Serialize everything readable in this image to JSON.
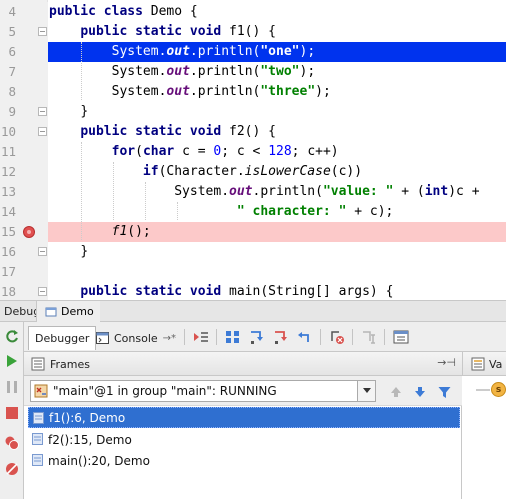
{
  "editor": {
    "lines": [
      {
        "num": "4"
      },
      {
        "num": "5"
      },
      {
        "num": "6"
      },
      {
        "num": "7"
      },
      {
        "num": "8"
      },
      {
        "num": "9"
      },
      {
        "num": "10"
      },
      {
        "num": "11"
      },
      {
        "num": "12"
      },
      {
        "num": "13"
      },
      {
        "num": "14"
      },
      {
        "num": "15"
      },
      {
        "num": "16"
      },
      {
        "num": "17"
      },
      {
        "num": "18"
      }
    ],
    "code": {
      "l4": {
        "kw": "public class",
        "rest": " Demo {"
      },
      "l5": {
        "kw": "public static void",
        "rest": " f1() {"
      },
      "l6": {
        "a": "System.",
        "fld": "out",
        "b": ".println(",
        "str": "\"one\"",
        "c": ");"
      },
      "l7": {
        "a": "System.",
        "fld": "out",
        "b": ".println(",
        "str": "\"two\"",
        "c": ");"
      },
      "l8": {
        "a": "System.",
        "fld": "out",
        "b": ".println(",
        "str": "\"three\"",
        "c": ");"
      },
      "l9": {
        "rest": "}"
      },
      "l10": {
        "kw": "public static void",
        "rest": " f2() {"
      },
      "l11": {
        "kw1": "for",
        "a": "(",
        "kw2": "char",
        "b": " c = ",
        "n1": "0",
        "c": "; c < ",
        "n2": "128",
        "d": "; c++)"
      },
      "l12": {
        "kw": "if",
        "a": "(Character.",
        "sm": "isLowerCase",
        "b": "(c))"
      },
      "l13": {
        "a": "System.",
        "fld": "out",
        "b": ".println(",
        "str": "\"value: \"",
        "c": " + (",
        "kw": "int",
        "d": ")c +"
      },
      "l14": {
        "str": "\" character: \"",
        "c": " + c);"
      },
      "l15": {
        "sm": "f1",
        "rest": "();"
      },
      "l16": {
        "rest": "}"
      },
      "l17": {
        "rest": ""
      },
      "l18": {
        "kw": "public static void",
        "rest": " main(String[] args) {"
      }
    }
  },
  "debug_bar": {
    "label": "Debug",
    "tab_label": "Demo"
  },
  "toolbar": {
    "debugger_tab": "Debugger",
    "console_tab": "Console",
    "console_suffix": "→*"
  },
  "frames_panel": {
    "title": "Frames",
    "pin": "→⊣",
    "thread": "\"main\"@1 in group \"main\": RUNNING",
    "frames": [
      {
        "label": "f1():6, Demo",
        "selected": true
      },
      {
        "label": "f2():15, Demo",
        "selected": false
      },
      {
        "label": "main():20, Demo",
        "selected": false
      }
    ]
  },
  "variables_panel": {
    "title": "Va",
    "badge": "s"
  },
  "colors": {
    "current_line": "#0033ee",
    "breakpoint_line": "#fcc9c9",
    "keyword": "#000080",
    "string": "#008000",
    "number": "#0000ff",
    "field": "#660e7a",
    "selected_frame": "#2f6fd0"
  }
}
